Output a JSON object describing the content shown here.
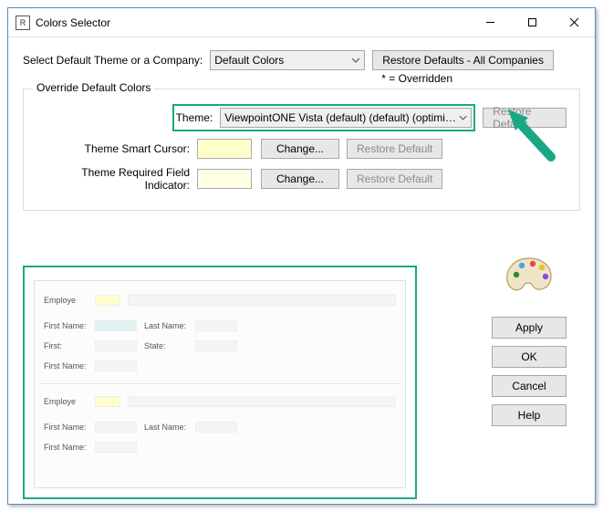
{
  "window": {
    "title": "Colors Selector"
  },
  "top": {
    "label": "Select Default Theme or a Company:",
    "theme_combo": "Default Colors",
    "restore_all": "Restore Defaults - All Companies",
    "overridden_note": "* = Overridden"
  },
  "group": {
    "title": "Override Default Colors",
    "theme_label": "Theme:",
    "theme_combo": "ViewpointONE Vista (default) (default) (optimized for",
    "theme_restore": "Restore Default",
    "cursor_label": "Theme Smart Cursor:",
    "cursor_change": "Change...",
    "cursor_restore": "Restore Default",
    "required_label": "Theme Required Field Indicator:",
    "required_change": "Change...",
    "required_restore": "Restore Default"
  },
  "preview": {
    "employe": "Employe",
    "first_name": "First Name:",
    "last_name": "Last Name:",
    "first": "First:",
    "state": "State:"
  },
  "buttons": {
    "apply": "Apply",
    "ok": "OK",
    "cancel": "Cancel",
    "help": "Help"
  },
  "colors": {
    "accent": "#19a884",
    "cursor_swatch": "#ffffcc",
    "required_swatch": "#ffffe5"
  }
}
